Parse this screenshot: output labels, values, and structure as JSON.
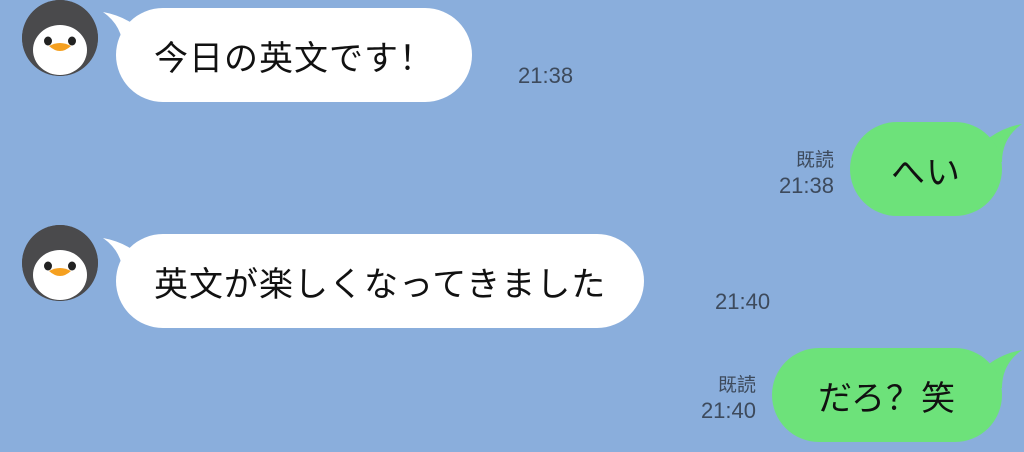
{
  "colors": {
    "background": "#8aaedc",
    "incoming_bubble": "#ffffff",
    "outgoing_bubble": "#6de27a",
    "meta_text": "#3d4a5c"
  },
  "messages": [
    {
      "direction": "incoming",
      "avatar": "penguin-avatar",
      "text": "今日の英文です！",
      "time": "21:38"
    },
    {
      "direction": "outgoing",
      "text": "へい",
      "read": "既読",
      "time": "21:38"
    },
    {
      "direction": "incoming",
      "avatar": "penguin-avatar",
      "text": "英文が楽しくなってきました",
      "time": "21:40"
    },
    {
      "direction": "outgoing",
      "text": "だろ？笑",
      "read": "既読",
      "time": "21:40"
    }
  ]
}
